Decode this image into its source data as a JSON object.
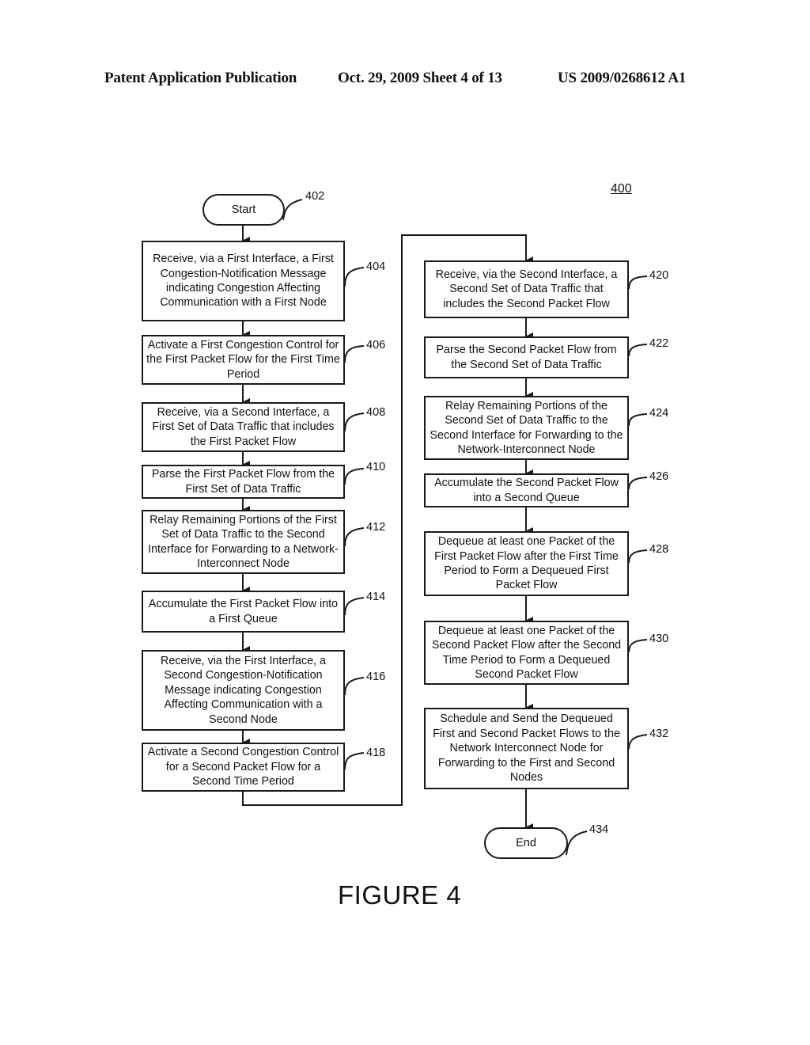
{
  "header": {
    "left": "Patent Application Publication",
    "middle": "Oct. 29, 2009  Sheet 4 of 13",
    "right": "US 2009/0268612 A1"
  },
  "figure_number": "400",
  "caption": "FIGURE 4",
  "nodes": {
    "start": {
      "ref": "402",
      "text": "Start"
    },
    "n404": {
      "ref": "404",
      "text": "Receive, via a First Interface, a First Congestion-Notification Message indicating Congestion Affecting Communication with a First Node"
    },
    "n406": {
      "ref": "406",
      "text": "Activate a First Congestion Control for the First Packet Flow for the First Time Period"
    },
    "n408": {
      "ref": "408",
      "text": "Receive, via a Second Interface, a First Set of Data Traffic that includes the First Packet Flow"
    },
    "n410": {
      "ref": "410",
      "text": "Parse the First Packet Flow from the First Set of Data Traffic"
    },
    "n412": {
      "ref": "412",
      "text": "Relay Remaining Portions of the First Set of Data Traffic to the Second Interface for Forwarding to a Network-Interconnect Node"
    },
    "n414": {
      "ref": "414",
      "text": "Accumulate the First Packet Flow into a First Queue"
    },
    "n416": {
      "ref": "416",
      "text": "Receive, via the First Interface, a Second Congestion-Notification Message indicating Congestion Affecting Communication with a Second Node"
    },
    "n418": {
      "ref": "418",
      "text": "Activate a Second Congestion Control for a Second Packet Flow for a Second Time Period"
    },
    "n420": {
      "ref": "420",
      "text": "Receive, via the Second Interface, a Second Set of Data Traffic that includes the Second Packet Flow"
    },
    "n422": {
      "ref": "422",
      "text": "Parse the Second Packet Flow from the Second Set of Data Traffic"
    },
    "n424": {
      "ref": "424",
      "text": "Relay Remaining Portions of the Second Set of Data Traffic to the Second Interface for Forwarding to the Network-Interconnect Node"
    },
    "n426": {
      "ref": "426",
      "text": "Accumulate the Second Packet Flow into a Second Queue"
    },
    "n428": {
      "ref": "428",
      "text": "Dequeue at least one Packet of the First Packet Flow after the First Time Period to Form a Dequeued First Packet Flow"
    },
    "n430": {
      "ref": "430",
      "text": "Dequeue at least one Packet of the Second Packet Flow after the Second Time Period to Form a Dequeued Second Packet Flow"
    },
    "n432": {
      "ref": "432",
      "text": "Schedule and Send the Dequeued First and Second Packet Flows to the Network Interconnect Node for Forwarding to the First and Second Nodes"
    },
    "end": {
      "ref": "434",
      "text": "End"
    }
  },
  "edges": [
    [
      "start",
      "n404"
    ],
    [
      "n404",
      "n406"
    ],
    [
      "n406",
      "n408"
    ],
    [
      "n408",
      "n410"
    ],
    [
      "n410",
      "n412"
    ],
    [
      "n412",
      "n414"
    ],
    [
      "n414",
      "n416"
    ],
    [
      "n416",
      "n418"
    ],
    [
      "n418",
      "n420"
    ],
    [
      "n420",
      "n422"
    ],
    [
      "n422",
      "n424"
    ],
    [
      "n424",
      "n426"
    ],
    [
      "n426",
      "n428"
    ],
    [
      "n428",
      "n430"
    ],
    [
      "n430",
      "n432"
    ],
    [
      "n432",
      "end"
    ]
  ]
}
